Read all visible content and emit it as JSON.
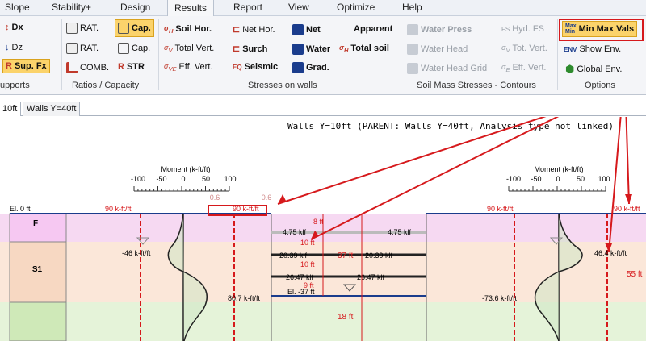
{
  "menu": {
    "tabs": [
      "Slope",
      "Stability+",
      "Design",
      "Results",
      "Report",
      "View",
      "Optimize",
      "Help"
    ],
    "active": "Results"
  },
  "ribbon": {
    "supports": {
      "dx": "Dx",
      "dz": "Dz",
      "supfx": "Sup. Fx",
      "label": "upports"
    },
    "ratios": {
      "rat1": "RAT.",
      "rat2": "RAT.",
      "comb": "COMB.",
      "cap1": "Cap.",
      "cap2": "Cap.",
      "str": "STR",
      "label": "Ratios / Capacity"
    },
    "stresses": {
      "soil_hor": "Soil Hor.",
      "total_vert": "Total Vert.",
      "eff_vert": "Eff. Vert.",
      "net_hor": "Net Hor.",
      "surch": "Surch",
      "seismic": "Seismic",
      "net": "Net",
      "water": "Water",
      "grad": "Grad.",
      "apparent": "Apparent",
      "total_soil": "Total soil",
      "label": "Stresses on walls"
    },
    "soil_mass": {
      "water_press": "Water Press",
      "water_head": "Water Head",
      "water_head_grid": "Water Head Grid",
      "hyd_fs": "Hyd. FS",
      "tot_vert": "Tot. Vert.",
      "eff_vert": "Eff. Vert.",
      "label": "Soil Mass Stresses - Contours"
    },
    "options": {
      "min_max_vals": "Min Max Vals",
      "show_env": "Show Env.",
      "global_env": "Global Env.",
      "label": "Options",
      "min_max_icon_top": "Max",
      "min_max_icon_bottom": "Min",
      "env_icon": "ENV"
    }
  },
  "doc_tabs": [
    "10ft",
    "Walls Y=40ft"
  ],
  "drawing": {
    "title": "Walls Y=10ft (PARENT: Walls Y=40ft, Analysis type not linked)",
    "moment_title": "Moment (k-ft/ft)",
    "moment_ticks": [
      "-100",
      "-50",
      "0",
      "50",
      "100"
    ],
    "ratio_ticks": [
      "0.6",
      "0.6"
    ],
    "elevation_top": "El. 0 ft",
    "elevation_bottom": "El. -37 ft",
    "layers": [
      "F",
      "S1"
    ],
    "left_min": "-46 k-ft/ft",
    "left_max": "80.7 k-ft/ft",
    "right_max": "46.4 k-ft/ft",
    "right_min": "-73.6 k-ft/ft",
    "cap_label_1": "90 k-ft/ft",
    "cap_label_2": "90 k-ft/ft",
    "cap_label_3": "90 k-ft/ft",
    "cap_label_4": "90 k-ft/ft",
    "strut_forces": [
      "4.75 klf",
      "4.75 klf",
      "20.39 klf",
      "20.39 klf",
      "26.47 klf",
      "26.47 klf"
    ],
    "dims": [
      "8 ft",
      "10 ft",
      "37 ft",
      "10 ft",
      "9 ft",
      "18 ft",
      "55 ft"
    ]
  },
  "colors": {
    "accent_red": "#d6191c",
    "layer_f": "#f6c8f2",
    "layer_s1": "#f7d8c2",
    "layer_green": "#cfe9b8"
  }
}
